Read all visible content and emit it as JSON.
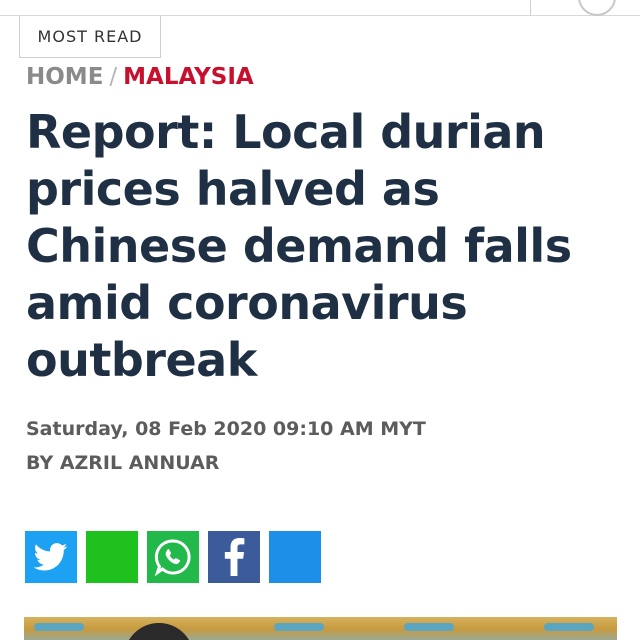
{
  "tabs": {
    "most_read_label": "MOST READ"
  },
  "breadcrumb": {
    "home_label": "HOME",
    "separator": "/",
    "section_label": "MALAYSIA"
  },
  "article": {
    "headline": "Report: Local durian prices halved as Chinese demand falls amid coronavirus outbreak",
    "dateline": "Saturday, 08 Feb 2020 09:10 AM MYT",
    "byline": "BY AZRIL ANNUAR"
  },
  "share": {
    "buttons": [
      {
        "icon": "twitter-icon",
        "color": "#1da1f2"
      },
      {
        "icon": "line-icon",
        "color": "#1fc11f"
      },
      {
        "icon": "whatsapp-icon",
        "color": "#22b84a"
      },
      {
        "icon": "facebook-icon",
        "color": "#3b5b9a"
      },
      {
        "icon": "share-icon",
        "color": "#1d8fe8"
      }
    ]
  },
  "colors": {
    "headline": "#1f3045",
    "section_accent": "#c8102e",
    "meta_text": "#5c5c5c"
  }
}
